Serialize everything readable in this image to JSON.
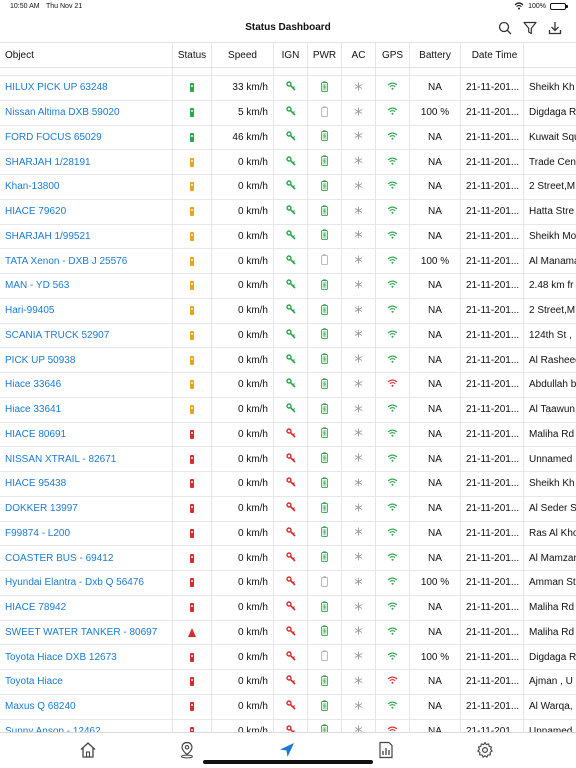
{
  "status_bar": {
    "time": "10:50 AM",
    "date": "Thu Nov 21",
    "battery": "100%"
  },
  "nav": {
    "title": "Status Dashboard",
    "icons": [
      "search-icon",
      "filter-icon",
      "download-icon"
    ]
  },
  "table": {
    "columns": [
      "Object",
      "Status",
      "Speed",
      "IGN",
      "PWR",
      "AC",
      "GPS",
      "Battery",
      "Date Time",
      ""
    ],
    "rows": [
      {
        "object": "HILUX PICK UP 63248",
        "status": "green",
        "speed": "33 km/h",
        "ign": "on",
        "pwr": "on",
        "gps": "on",
        "battery": "NA",
        "datetime": "21-11-201...",
        "address": "Sheikh Kh"
      },
      {
        "object": "Nissan Altima DXB 59020",
        "status": "green",
        "speed": "5 km/h",
        "ign": "on",
        "pwr": "off",
        "gps": "on",
        "battery": "100 %",
        "datetime": "21-11-201...",
        "address": "Digdaga R"
      },
      {
        "object": "FORD FOCUS 65029",
        "status": "green",
        "speed": "46 km/h",
        "ign": "on",
        "pwr": "on",
        "gps": "on",
        "battery": "NA",
        "datetime": "21-11-201...",
        "address": "Kuwait Squ"
      },
      {
        "object": "SHARJAH 1/28191",
        "status": "yellow",
        "speed": "0 km/h",
        "ign": "on",
        "pwr": "on",
        "gps": "on",
        "battery": "NA",
        "datetime": "21-11-201...",
        "address": "Trade Cent"
      },
      {
        "object": "Khan-13800",
        "status": "yellow",
        "speed": "0 km/h",
        "ign": "on",
        "pwr": "on",
        "gps": "on",
        "battery": "NA",
        "datetime": "21-11-201...",
        "address": "2 Street,M"
      },
      {
        "object": "HIACE 79620",
        "status": "yellow",
        "speed": "0 km/h",
        "ign": "on",
        "pwr": "on",
        "gps": "on",
        "battery": "NA",
        "datetime": "21-11-201...",
        "address": "Hatta Stre"
      },
      {
        "object": "SHARJAH 1/99521",
        "status": "yellow",
        "speed": "0 km/h",
        "ign": "on",
        "pwr": "on",
        "gps": "on",
        "battery": "NA",
        "datetime": "21-11-201...",
        "address": "Sheikh Mo"
      },
      {
        "object": "TATA Xenon - DXB J 25576",
        "status": "yellow",
        "speed": "0 km/h",
        "ign": "on",
        "pwr": "off",
        "gps": "on",
        "battery": "100 %",
        "datetime": "21-11-201...",
        "address": "Al Manama"
      },
      {
        "object": "MAN - YD 563",
        "status": "yellow",
        "speed": "0 km/h",
        "ign": "on",
        "pwr": "on",
        "gps": "on",
        "battery": "NA",
        "datetime": "21-11-201...",
        "address": "2.48 km fr"
      },
      {
        "object": "Hari-99405",
        "status": "yellow",
        "speed": "0 km/h",
        "ign": "on",
        "pwr": "on",
        "gps": "on",
        "battery": "NA",
        "datetime": "21-11-201...",
        "address": "2 Street,M"
      },
      {
        "object": "SCANIA TRUCK 52907",
        "status": "yellow",
        "speed": "0 km/h",
        "ign": "on",
        "pwr": "on",
        "gps": "on",
        "battery": "NA",
        "datetime": "21-11-201...",
        "address": "124th St ,"
      },
      {
        "object": "PICK UP 50938",
        "status": "yellow",
        "speed": "0 km/h",
        "ign": "on",
        "pwr": "on",
        "gps": "on",
        "battery": "NA",
        "datetime": "21-11-201...",
        "address": "Al Rasheed"
      },
      {
        "object": "Hiace 33646",
        "status": "yellow",
        "speed": "0 km/h",
        "ign": "on",
        "pwr": "on",
        "gps": "off",
        "battery": "NA",
        "datetime": "21-11-201...",
        "address": "Abdullah b"
      },
      {
        "object": "Hiace 33641",
        "status": "yellow",
        "speed": "0 km/h",
        "ign": "on",
        "pwr": "on",
        "gps": "on",
        "battery": "NA",
        "datetime": "21-11-201...",
        "address": "Al Taawun"
      },
      {
        "object": "HIACE 80691",
        "status": "red",
        "speed": "0 km/h",
        "ign": "off",
        "pwr": "on",
        "gps": "on",
        "battery": "NA",
        "datetime": "21-11-201...",
        "address": "Maliha Rd"
      },
      {
        "object": "NISSAN XTRAIL - 82671",
        "status": "red",
        "speed": "0 km/h",
        "ign": "off",
        "pwr": "on",
        "gps": "on",
        "battery": "NA",
        "datetime": "21-11-201...",
        "address": "Unnamed"
      },
      {
        "object": "HIACE 95438",
        "status": "red",
        "speed": "0 km/h",
        "ign": "off",
        "pwr": "on",
        "gps": "on",
        "battery": "NA",
        "datetime": "21-11-201...",
        "address": "Sheikh Kh"
      },
      {
        "object": "DOKKER 13997",
        "status": "red",
        "speed": "0 km/h",
        "ign": "off",
        "pwr": "on",
        "gps": "on",
        "battery": "NA",
        "datetime": "21-11-201...",
        "address": "Al Seder S"
      },
      {
        "object": "F99874 - L200",
        "status": "red",
        "speed": "0 km/h",
        "ign": "off",
        "pwr": "on",
        "gps": "on",
        "battery": "NA",
        "datetime": "21-11-201...",
        "address": "Ras Al Kho"
      },
      {
        "object": "COASTER BUS - 69412",
        "status": "red",
        "speed": "0 km/h",
        "ign": "off",
        "pwr": "on",
        "gps": "on",
        "battery": "NA",
        "datetime": "21-11-201...",
        "address": "Al Mamzar"
      },
      {
        "object": "Hyundai Elantra - Dxb Q 56476",
        "status": "red",
        "speed": "0 km/h",
        "ign": "off",
        "pwr": "off",
        "gps": "on",
        "battery": "100 %",
        "datetime": "21-11-201...",
        "address": "Amman St"
      },
      {
        "object": "HIACE 78942",
        "status": "red",
        "speed": "0 km/h",
        "ign": "off",
        "pwr": "on",
        "gps": "on",
        "battery": "NA",
        "datetime": "21-11-201...",
        "address": "Maliha Rd"
      },
      {
        "object": "SWEET WATER TANKER - 80697",
        "status": "arrow-red",
        "speed": "0 km/h",
        "ign": "off",
        "pwr": "on",
        "gps": "on",
        "battery": "NA",
        "datetime": "21-11-201...",
        "address": "Maliha Rd"
      },
      {
        "object": "Toyota Hiace DXB 12673",
        "status": "red",
        "speed": "0 km/h",
        "ign": "off",
        "pwr": "off",
        "gps": "on",
        "battery": "100 %",
        "datetime": "21-11-201...",
        "address": "Digdaga R"
      },
      {
        "object": "Toyota Hiace",
        "status": "red",
        "speed": "0 km/h",
        "ign": "off",
        "pwr": "on",
        "gps": "off",
        "battery": "NA",
        "datetime": "21-11-201...",
        "address": "Ajman , U"
      },
      {
        "object": "Maxus  Q 68240",
        "status": "red",
        "speed": "0 km/h",
        "ign": "off",
        "pwr": "on",
        "gps": "on",
        "battery": "NA",
        "datetime": "21-11-201...",
        "address": "Al Warqa,"
      },
      {
        "object": "Sunny Ansop - 12462",
        "status": "red",
        "speed": "0 km/h",
        "ign": "off",
        "pwr": "on",
        "gps": "off",
        "battery": "NA",
        "datetime": "21-11-201...",
        "address": "Unnamed"
      }
    ]
  },
  "tabbar": {
    "tabs": [
      "home-icon",
      "location-pin-icon",
      "navigation-arrow-icon",
      "report-icon",
      "settings-gear-icon"
    ],
    "active": "navigation-arrow-icon"
  },
  "colors": {
    "link": "#1a7bd6",
    "green": "#2aa84a",
    "red": "#d92b2b",
    "yellow": "#e8a413",
    "accent": "#1a7bd6"
  }
}
